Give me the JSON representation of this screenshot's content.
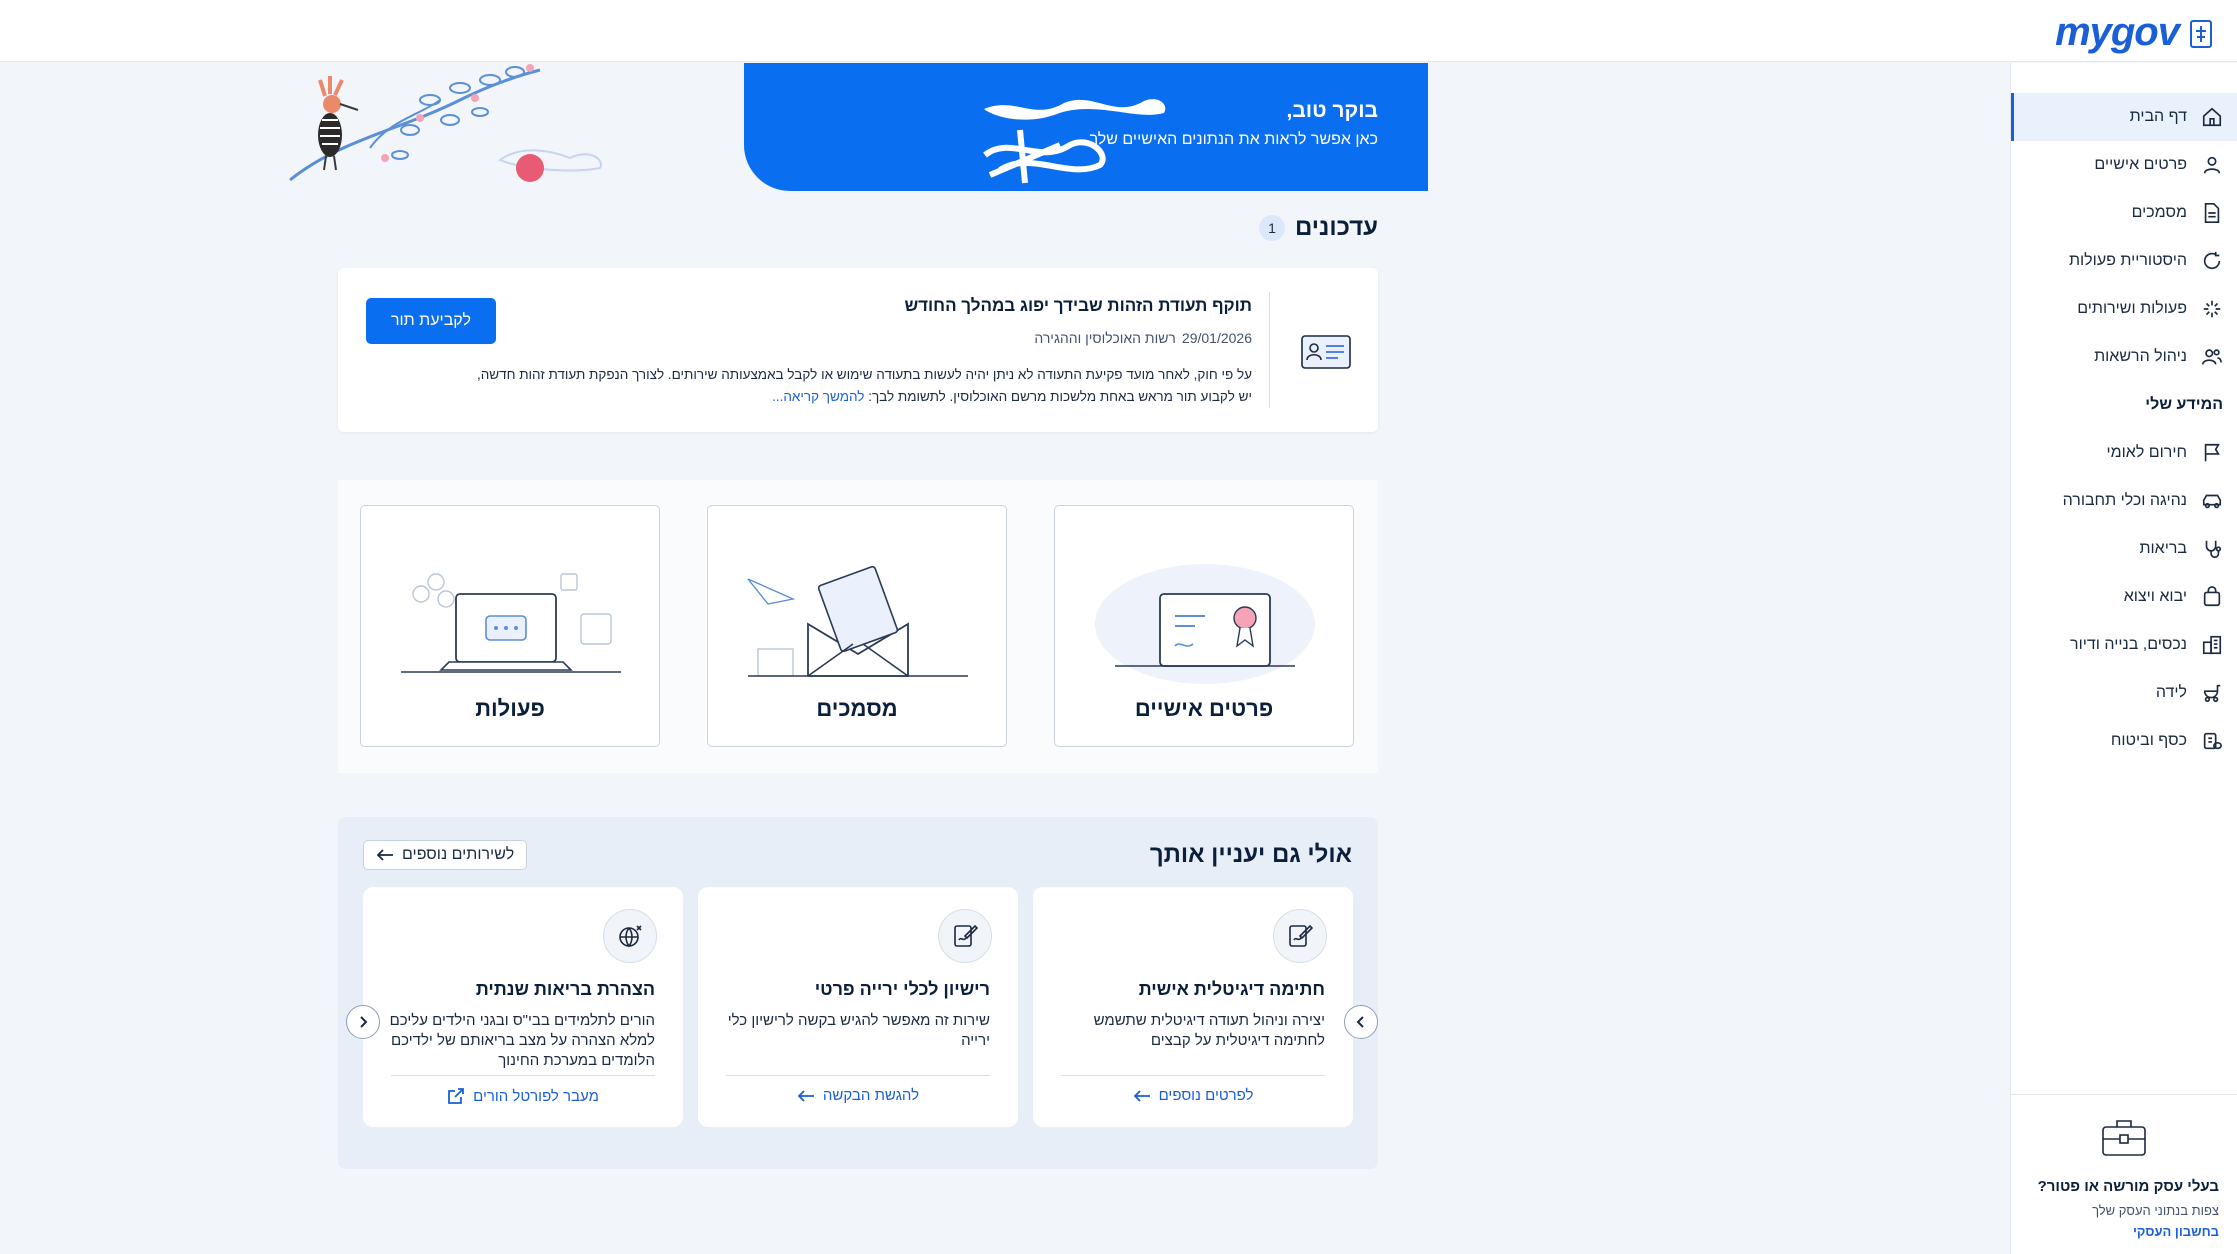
{
  "brand": {
    "logo": "mygov",
    "accent": "#0a6ef0"
  },
  "sidebar": {
    "items": [
      {
        "label": "דף הבית",
        "icon": "home-icon"
      },
      {
        "label": "פרטים אישיים",
        "icon": "user-icon"
      },
      {
        "label": "מסמכים",
        "icon": "document-icon"
      },
      {
        "label": "היסטוריית פעולות",
        "icon": "history-icon"
      },
      {
        "label": "פעולות ושירותים",
        "icon": "sparkle-icon"
      },
      {
        "label": "ניהול הרשאות",
        "icon": "users-icon"
      }
    ],
    "section_heading": "המידע שלי",
    "section_items": [
      {
        "label": "חירום לאומי",
        "icon": "flag-icon"
      },
      {
        "label": "נהיגה וכלי תחבורה",
        "icon": "car-icon"
      },
      {
        "label": "בריאות",
        "icon": "stethoscope-icon"
      },
      {
        "label": "יבוא ויצוא",
        "icon": "cart-icon"
      },
      {
        "label": "נכסים, בנייה ודיור",
        "icon": "buildings-icon"
      },
      {
        "label": "לידה",
        "icon": "stroller-icon"
      },
      {
        "label": "כסף וביטוח",
        "icon": "coins-icon"
      }
    ],
    "business": {
      "title": "בעלי עסק מורשה או פטור?",
      "subtitle": "צפות בנתוני העסק שלך",
      "link": "בחשבון העסקי"
    }
  },
  "hero": {
    "greeting": "בוקר טוב,",
    "subtitle": "כאן אפשר לראות את הנתונים האישיים שלך"
  },
  "updates": {
    "title": "עדכונים",
    "count": "1",
    "card": {
      "title": "תוקף תעודת הזהות שבידך יפוג במהלך החודש",
      "date": "29/01/2026",
      "source": "רשות האוכלוסין וההגירה",
      "body": "על פי חוק, לאחר מועד פקיעת התעודה לא ניתן יהיה לעשות בתעודה שימוש או לקבל באמצעותה שירותים. לצורך הנפקת תעודת זהות חדשה, יש לקבוע תור מראש באחת מלשכות מרשם האוכלוסין. לתשומת לבך: ",
      "read_more": "להמשך קריאה...",
      "button": "לקביעת תור"
    }
  },
  "tiles": [
    {
      "label": "פרטים אישיים"
    },
    {
      "label": "מסמכים"
    },
    {
      "label": "פעולות"
    }
  ],
  "recommendations": {
    "title": "אולי גם יעניין אותך",
    "more_button": "לשירותים נוספים",
    "cards": [
      {
        "title": "חתימה דיגיטלית אישית",
        "desc": "יצירה וניהול תעודה דיגיטלית שתשמש לחתימה דיגיטלית על קבצים",
        "link": "לפרטים נוספים",
        "icon": "signature-icon"
      },
      {
        "title": "רישיון לכלי ירייה פרטי",
        "desc": "שירות זה מאפשר להגיש בקשה לרישיון כלי ירייה",
        "link": "להגשת הבקשה",
        "icon": "signature-icon"
      },
      {
        "title": "הצהרת בריאות שנתית",
        "desc": "הורים לתלמידים בבי\"ס ובגני הילדים עליכם למלא הצהרה על מצב בריאותם של ילדיכם הלומדים במערכת החינוך",
        "link": "מעבר לפורטל הורים",
        "icon": "globe-icon"
      }
    ]
  }
}
